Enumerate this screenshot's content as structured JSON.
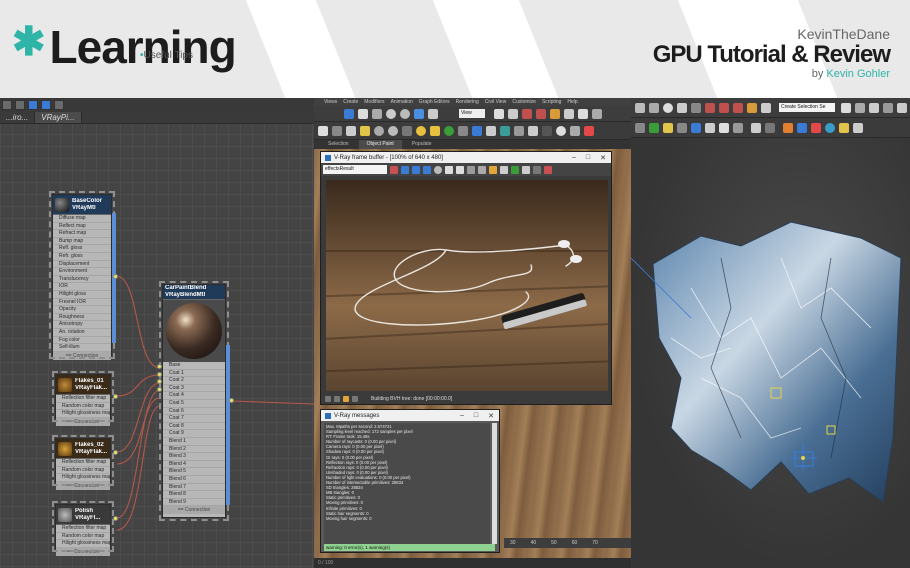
{
  "banner": {
    "logo_word": "Learning",
    "logo_sub": "Useful Tips",
    "author_top": "KevinTheDane",
    "title": "GPU Tutorial & Review",
    "byline_prefix": "by",
    "byline_name": "Kevin Gohler",
    "colors": {
      "accent": "#2fb5a8",
      "dark": "#1d1d1d"
    }
  },
  "slate": {
    "tabs": [
      "...iro...",
      "VRayPi..."
    ],
    "nodes": [
      {
        "id": "basecolor",
        "title": [
          "BaseColor",
          "VRayMtl"
        ],
        "rows": [
          "Diffuse map",
          "Reflect map",
          "Refract map",
          "Bump map",
          "Refl. gloss",
          "Refr. gloss",
          "Displacement",
          "Environment",
          "Translucency",
          "IOR",
          "Hilight gloss",
          "Fresnel IOR",
          "Opacity",
          "Roughness",
          "Anisotropy",
          "An. rotation",
          "Fog color",
          "Self-illum"
        ],
        "footer": "== Connection"
      },
      {
        "id": "flakes01",
        "title": [
          "Flakes_01",
          "VRayFlak..."
        ],
        "rows": [
          "Reflection filter map",
          "Random color map",
          "Hilight glossiness map"
        ],
        "footer": "== Connection"
      },
      {
        "id": "flakes02",
        "title": [
          "Flakes_02",
          "VRayFlak..."
        ],
        "rows": [
          "Reflection filter map",
          "Random color map",
          "Hilight glossiness map"
        ],
        "footer": "== Connection"
      },
      {
        "id": "polish",
        "title": [
          "Polish",
          "VRayFl..."
        ],
        "rows": [
          "Reflection filter map",
          "Random color map",
          "Hilight glossiness map"
        ],
        "footer": "== Connection"
      },
      {
        "id": "blend",
        "title": [
          "CarPaintBlend",
          "VRayBlendMtl"
        ],
        "rows": [
          "Base",
          "Coat 1",
          "Coat 2",
          "Coat 3",
          "Coat 4",
          "Coat 5",
          "Coat 6",
          "Coat 7",
          "Coat 8",
          "Coat 9",
          "Blend 1",
          "Blend 2",
          "Blend 3",
          "Blend 4",
          "Blend 5",
          "Blend 6",
          "Blend 7",
          "Blend 8",
          "Blend 9"
        ],
        "footer": "== Connection"
      }
    ]
  },
  "max_ui": {
    "menu": [
      "Views",
      "Create",
      "Modifiers",
      "Animation",
      "Graph Editors",
      "Rendering",
      "Civil View",
      "Customize",
      "Scripting",
      "Help"
    ],
    "ribbon_tabs": [
      "Selection",
      "Object Paint",
      "Populate"
    ],
    "ribbon_active": "Object Paint",
    "view_dropdown": "View",
    "frame_buffer": {
      "title": "V-Ray frame buffer - [100% of 640 x 480]",
      "channel": "effectsResult",
      "status": "Building BVH tree: done [00:00:00.0]"
    },
    "messages": {
      "title": "V-Ray messages",
      "lines": [
        "Max. Mpaths per second: 2.574721",
        "Sampling level reached: 172 samples per pixel",
        "RT: Frame took: 15.49s",
        "Number of raycasts: 0 (0.00 per pixel)",
        "Camera rays: 0 (0.00 per pixel)",
        "Shadow rays: 0 (0.00 per pixel)",
        "GI rays: 0 (0.00 per pixel)",
        "Reflection rays: 0 (0.00 per pixel)",
        "Refraction rays: 0 (0.00 per pixel)",
        "Unshaded rays: 0 (0.00 per pixel)",
        "Number of light evaluations: 0 (0.00 per pixel)",
        "Number of intersectable primitives: 28834",
        "SD triangles: 28834",
        "MB triangles: 0",
        "Static primitives: 0",
        "Moving primitives: 0",
        "Infinite primitives: 0",
        "Static hair segments: 0",
        "Moving hair segments: 0"
      ],
      "warning": "warning: 0 error(s), 1 warning(s)"
    },
    "timeline_ticks": [
      "30",
      "40",
      "50",
      "60",
      "70"
    ],
    "status": "0 / 100"
  },
  "viewport_ui": {
    "selection_set": "Create Selection Se"
  }
}
